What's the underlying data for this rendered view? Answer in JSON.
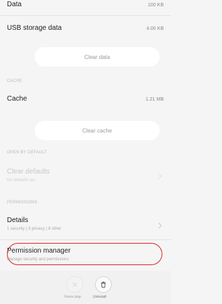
{
  "rows": {
    "data": {
      "title": "Data",
      "value": "100 KB"
    },
    "usb": {
      "title": "USB storage data",
      "value": "4.00 KB"
    },
    "cache": {
      "title": "Cache",
      "value": "1.21 MB"
    }
  },
  "buttons": {
    "clear_data": "Clear data",
    "clear_cache": "Clear cache"
  },
  "sections": {
    "cache": "CACHE",
    "open_by_default": "OPEN BY DEFAULT",
    "permissions": "PERMISSIONS"
  },
  "defaults": {
    "title": "Clear defaults",
    "subtitle": "No defaults set."
  },
  "details": {
    "title": "Details",
    "subtitle": "1 security | 3 privacy | 8 other"
  },
  "permission_manager": {
    "title": "Permission manager",
    "subtitle": "Manage security and permissions"
  },
  "bottom": {
    "force_stop": "Force stop",
    "uninstall": "Uninstall"
  },
  "colors": {
    "highlight": "#d8232a"
  }
}
